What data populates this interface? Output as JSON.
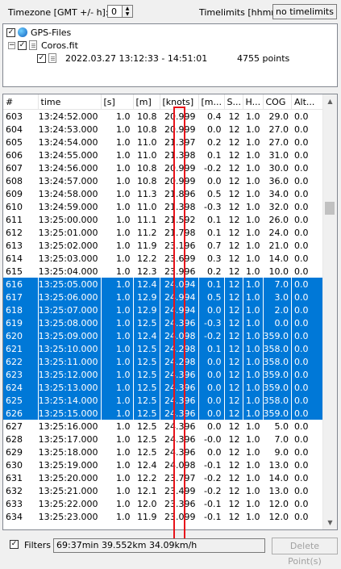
{
  "toolbar": {
    "timezone_label": "Timezone [GMT +/- h]:",
    "timezone_value": "0",
    "timelimits_label": "Timelimits [hhmm]:",
    "timelimits_value": "no timelimits"
  },
  "tree": {
    "root_label": "GPS-Files",
    "file_label": "Coros.fit",
    "track_label": "2022.03.27 13:12:33 - 14:51:01",
    "track_points": "4755 points"
  },
  "table": {
    "columns": [
      "#",
      "time",
      "[s]",
      "[m]",
      "[knots]",
      "[m...",
      "S...",
      "H...",
      "COG",
      "Alt..."
    ],
    "rows": [
      {
        "n": "603",
        "time": "13:24:52.000",
        "s": "1.0",
        "m": "10.8",
        "kn": "20.999",
        "m2": "0.4",
        "sat": "12",
        "h": "1.0",
        "cog": "29.0",
        "alt": "0.0",
        "sel": false
      },
      {
        "n": "604",
        "time": "13:24:53.000",
        "s": "1.0",
        "m": "10.8",
        "kn": "20.999",
        "m2": "0.0",
        "sat": "12",
        "h": "1.0",
        "cog": "27.0",
        "alt": "0.0",
        "sel": false
      },
      {
        "n": "605",
        "time": "13:24:54.000",
        "s": "1.0",
        "m": "11.0",
        "kn": "21.397",
        "m2": "0.2",
        "sat": "12",
        "h": "1.0",
        "cog": "27.0",
        "alt": "0.0",
        "sel": false
      },
      {
        "n": "606",
        "time": "13:24:55.000",
        "s": "1.0",
        "m": "11.0",
        "kn": "21.398",
        "m2": "0.1",
        "sat": "12",
        "h": "1.0",
        "cog": "31.0",
        "alt": "0.0",
        "sel": false
      },
      {
        "n": "607",
        "time": "13:24:56.000",
        "s": "1.0",
        "m": "10.8",
        "kn": "20.999",
        "m2": "-0.2",
        "sat": "12",
        "h": "1.0",
        "cog": "30.0",
        "alt": "0.0",
        "sel": false
      },
      {
        "n": "608",
        "time": "13:24:57.000",
        "s": "1.0",
        "m": "10.8",
        "kn": "20.999",
        "m2": "0.0",
        "sat": "12",
        "h": "1.0",
        "cog": "36.0",
        "alt": "0.0",
        "sel": false
      },
      {
        "n": "609",
        "time": "13:24:58.000",
        "s": "1.0",
        "m": "11.3",
        "kn": "21.896",
        "m2": "0.5",
        "sat": "12",
        "h": "1.0",
        "cog": "34.0",
        "alt": "0.0",
        "sel": false
      },
      {
        "n": "610",
        "time": "13:24:59.000",
        "s": "1.0",
        "m": "11.0",
        "kn": "21.398",
        "m2": "-0.3",
        "sat": "12",
        "h": "1.0",
        "cog": "32.0",
        "alt": "0.0",
        "sel": false
      },
      {
        "n": "611",
        "time": "13:25:00.000",
        "s": "1.0",
        "m": "11.1",
        "kn": "21.592",
        "m2": "0.1",
        "sat": "12",
        "h": "1.0",
        "cog": "26.0",
        "alt": "0.0",
        "sel": false
      },
      {
        "n": "612",
        "time": "13:25:01.000",
        "s": "1.0",
        "m": "11.2",
        "kn": "21.798",
        "m2": "0.1",
        "sat": "12",
        "h": "1.0",
        "cog": "24.0",
        "alt": "0.0",
        "sel": false
      },
      {
        "n": "613",
        "time": "13:25:02.000",
        "s": "1.0",
        "m": "11.9",
        "kn": "23.196",
        "m2": "0.7",
        "sat": "12",
        "h": "1.0",
        "cog": "21.0",
        "alt": "0.0",
        "sel": false
      },
      {
        "n": "614",
        "time": "13:25:03.000",
        "s": "1.0",
        "m": "12.2",
        "kn": "23.699",
        "m2": "0.3",
        "sat": "12",
        "h": "1.0",
        "cog": "14.0",
        "alt": "0.0",
        "sel": false
      },
      {
        "n": "615",
        "time": "13:25:04.000",
        "s": "1.0",
        "m": "12.3",
        "kn": "23.996",
        "m2": "0.2",
        "sat": "12",
        "h": "1.0",
        "cog": "10.0",
        "alt": "0.0",
        "sel": false
      },
      {
        "n": "616",
        "time": "13:25:05.000",
        "s": "1.0",
        "m": "12.4",
        "kn": "24.094",
        "m2": "0.1",
        "sat": "12",
        "h": "1.0",
        "cog": "7.0",
        "alt": "0.0",
        "sel": true
      },
      {
        "n": "617",
        "time": "13:25:06.000",
        "s": "1.0",
        "m": "12.9",
        "kn": "24.994",
        "m2": "0.5",
        "sat": "12",
        "h": "1.0",
        "cog": "3.0",
        "alt": "0.0",
        "sel": true
      },
      {
        "n": "618",
        "time": "13:25:07.000",
        "s": "1.0",
        "m": "12.9",
        "kn": "24.994",
        "m2": "0.0",
        "sat": "12",
        "h": "1.0",
        "cog": "2.0",
        "alt": "0.0",
        "sel": true
      },
      {
        "n": "619",
        "time": "13:25:08.000",
        "s": "1.0",
        "m": "12.5",
        "kn": "24.396",
        "m2": "-0.3",
        "sat": "12",
        "h": "1.0",
        "cog": "0.0",
        "alt": "0.0",
        "sel": true
      },
      {
        "n": "620",
        "time": "13:25:09.000",
        "s": "1.0",
        "m": "12.4",
        "kn": "24.098",
        "m2": "-0.2",
        "sat": "12",
        "h": "1.0",
        "cog": "359.0",
        "alt": "0.0",
        "sel": true
      },
      {
        "n": "621",
        "time": "13:25:10.000",
        "s": "1.0",
        "m": "12.5",
        "kn": "24.298",
        "m2": "0.1",
        "sat": "12",
        "h": "1.0",
        "cog": "358.0",
        "alt": "0.0",
        "sel": true
      },
      {
        "n": "622",
        "time": "13:25:11.000",
        "s": "1.0",
        "m": "12.5",
        "kn": "24.298",
        "m2": "0.0",
        "sat": "12",
        "h": "1.0",
        "cog": "358.0",
        "alt": "0.0",
        "sel": true
      },
      {
        "n": "623",
        "time": "13:25:12.000",
        "s": "1.0",
        "m": "12.5",
        "kn": "24.396",
        "m2": "0.0",
        "sat": "12",
        "h": "1.0",
        "cog": "359.0",
        "alt": "0.0",
        "sel": true
      },
      {
        "n": "624",
        "time": "13:25:13.000",
        "s": "1.0",
        "m": "12.5",
        "kn": "24.396",
        "m2": "0.0",
        "sat": "12",
        "h": "1.0",
        "cog": "359.0",
        "alt": "0.0",
        "sel": true
      },
      {
        "n": "625",
        "time": "13:25:14.000",
        "s": "1.0",
        "m": "12.5",
        "kn": "24.396",
        "m2": "0.0",
        "sat": "12",
        "h": "1.0",
        "cog": "358.0",
        "alt": "0.0",
        "sel": true
      },
      {
        "n": "626",
        "time": "13:25:15.000",
        "s": "1.0",
        "m": "12.5",
        "kn": "24.396",
        "m2": "0.0",
        "sat": "12",
        "h": "1.0",
        "cog": "359.0",
        "alt": "0.0",
        "sel": true
      },
      {
        "n": "627",
        "time": "13:25:16.000",
        "s": "1.0",
        "m": "12.5",
        "kn": "24.396",
        "m2": "0.0",
        "sat": "12",
        "h": "1.0",
        "cog": "5.0",
        "alt": "0.0",
        "sel": false
      },
      {
        "n": "628",
        "time": "13:25:17.000",
        "s": "1.0",
        "m": "12.5",
        "kn": "24.396",
        "m2": "-0.0",
        "sat": "12",
        "h": "1.0",
        "cog": "7.0",
        "alt": "0.0",
        "sel": false
      },
      {
        "n": "629",
        "time": "13:25:18.000",
        "s": "1.0",
        "m": "12.5",
        "kn": "24.396",
        "m2": "0.0",
        "sat": "12",
        "h": "1.0",
        "cog": "9.0",
        "alt": "0.0",
        "sel": false
      },
      {
        "n": "630",
        "time": "13:25:19.000",
        "s": "1.0",
        "m": "12.4",
        "kn": "24.098",
        "m2": "-0.1",
        "sat": "12",
        "h": "1.0",
        "cog": "13.0",
        "alt": "0.0",
        "sel": false
      },
      {
        "n": "631",
        "time": "13:25:20.000",
        "s": "1.0",
        "m": "12.2",
        "kn": "23.797",
        "m2": "-0.2",
        "sat": "12",
        "h": "1.0",
        "cog": "14.0",
        "alt": "0.0",
        "sel": false
      },
      {
        "n": "632",
        "time": "13:25:21.000",
        "s": "1.0",
        "m": "12.1",
        "kn": "23.499",
        "m2": "-0.2",
        "sat": "12",
        "h": "1.0",
        "cog": "13.0",
        "alt": "0.0",
        "sel": false
      },
      {
        "n": "633",
        "time": "13:25:22.000",
        "s": "1.0",
        "m": "12.0",
        "kn": "23.396",
        "m2": "-0.1",
        "sat": "12",
        "h": "1.0",
        "cog": "12.0",
        "alt": "0.0",
        "sel": false
      },
      {
        "n": "634",
        "time": "13:25:23.000",
        "s": "1.0",
        "m": "11.9",
        "kn": "23.099",
        "m2": "-0.1",
        "sat": "12",
        "h": "1.0",
        "cog": "12.0",
        "alt": "0.0",
        "sel": false
      }
    ]
  },
  "footer": {
    "filters_label": "Filters",
    "status_text": "69:37min 39.552km 34.09km/h",
    "delete_button": "Delete Point(s)"
  }
}
